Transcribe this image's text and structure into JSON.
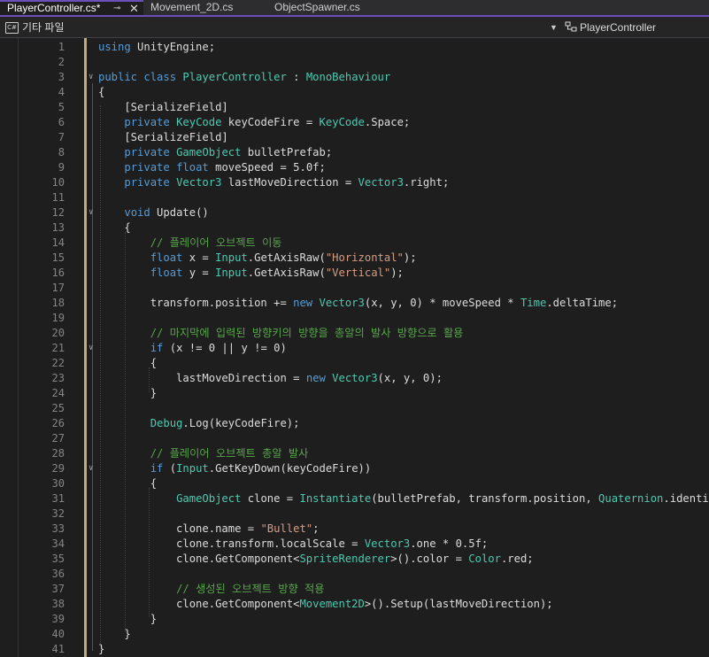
{
  "tabs": [
    {
      "label": "PlayerController.cs*",
      "active": true,
      "pin_icon": "pin-icon",
      "close_icon": "close-icon",
      "pin": "⊸",
      "close": "✕"
    },
    {
      "label": "Movement_2D.cs",
      "active": false
    },
    {
      "label": "ObjectSpawner.cs",
      "active": false
    }
  ],
  "navbar": {
    "project_label": "기타 파일",
    "project_icon": "C#",
    "dropdown_icon": "chevron-down-icon",
    "member_label": "PlayerController"
  },
  "colors": {
    "accent": "#6b4fbb",
    "keyword": "#569cd6",
    "type": "#4ec9b0",
    "string": "#d69d85",
    "comment": "#57a64a",
    "modified_bar": "#d7ba7d"
  },
  "code_lines": [
    {
      "n": "1",
      "text": "using UnityEngine;"
    },
    {
      "n": "2",
      "text": ""
    },
    {
      "n": "3",
      "text": "public class PlayerController : MonoBehaviour"
    },
    {
      "n": "4",
      "text": "{"
    },
    {
      "n": "5",
      "text": "    [SerializeField]"
    },
    {
      "n": "6",
      "text": "    private KeyCode keyCodeFire = KeyCode.Space;"
    },
    {
      "n": "7",
      "text": "    [SerializeField]"
    },
    {
      "n": "8",
      "text": "    private GameObject bulletPrefab;"
    },
    {
      "n": "9",
      "text": "    private float moveSpeed = 5.0f;"
    },
    {
      "n": "10",
      "text": "    private Vector3 lastMoveDirection = Vector3.right;"
    },
    {
      "n": "11",
      "text": ""
    },
    {
      "n": "12",
      "text": "    void Update()"
    },
    {
      "n": "13",
      "text": "    {"
    },
    {
      "n": "14",
      "text": "        // 플레이어 오브젝트 이동"
    },
    {
      "n": "15",
      "text": "        float x = Input.GetAxisRaw(\"Horizontal\");"
    },
    {
      "n": "16",
      "text": "        float y = Input.GetAxisRaw(\"Vertical\");"
    },
    {
      "n": "17",
      "text": ""
    },
    {
      "n": "18",
      "text": "        transform.position += new Vector3(x, y, 0) * moveSpeed * Time.deltaTime;"
    },
    {
      "n": "19",
      "text": ""
    },
    {
      "n": "20",
      "text": "        // 마지막에 입력된 방향키의 방향을 총알의 발사 방향으로 활용"
    },
    {
      "n": "21",
      "text": "        if (x != 0 || y != 0)"
    },
    {
      "n": "22",
      "text": "        {"
    },
    {
      "n": "23",
      "text": "            lastMoveDirection = new Vector3(x, y, 0);"
    },
    {
      "n": "24",
      "text": "        }"
    },
    {
      "n": "25",
      "text": ""
    },
    {
      "n": "26",
      "text": "        Debug.Log(keyCodeFire);"
    },
    {
      "n": "27",
      "text": ""
    },
    {
      "n": "28",
      "text": "        // 플레이어 오브젝트 총알 발사"
    },
    {
      "n": "29",
      "text": "        if (Input.GetKeyDown(keyCodeFire))"
    },
    {
      "n": "30",
      "text": "        {"
    },
    {
      "n": "31",
      "text": "            GameObject clone = Instantiate(bulletPrefab, transform.position, Quaternion.identity);"
    },
    {
      "n": "32",
      "text": ""
    },
    {
      "n": "33",
      "text": "            clone.name = \"Bullet\";"
    },
    {
      "n": "34",
      "text": "            clone.transform.localScale = Vector3.one * 0.5f;"
    },
    {
      "n": "35",
      "text": "            clone.GetComponent<SpriteRenderer>().color = Color.red;"
    },
    {
      "n": "36",
      "text": ""
    },
    {
      "n": "37",
      "text": "            // 생성된 오브젝트 방향 적용"
    },
    {
      "n": "38",
      "text": "            clone.GetComponent<Movement2D>().Setup(lastMoveDirection);"
    },
    {
      "n": "39",
      "text": "        }"
    },
    {
      "n": "40",
      "text": "    }"
    },
    {
      "n": "41",
      "text": "}"
    }
  ]
}
